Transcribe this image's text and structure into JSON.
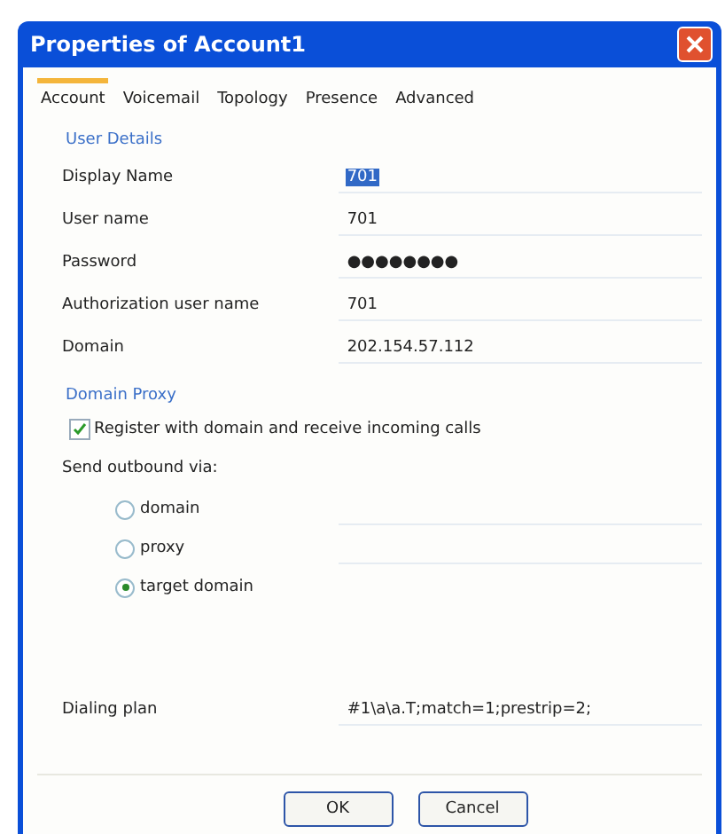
{
  "window": {
    "title": "Properties of Account1"
  },
  "tabs": [
    {
      "label": "Account",
      "selected": true
    },
    {
      "label": "Voicemail",
      "selected": false
    },
    {
      "label": "Topology",
      "selected": false
    },
    {
      "label": "Presence",
      "selected": false
    },
    {
      "label": "Advanced",
      "selected": false
    }
  ],
  "user_details": {
    "heading": "User Details",
    "fields": [
      {
        "label": "Display Name",
        "value": "701",
        "selected": true
      },
      {
        "label": "User name",
        "value": "701",
        "selected": false
      },
      {
        "label": "Password",
        "value": "●●●●●●●●",
        "selected": false
      },
      {
        "label": "Authorization user name",
        "value": "701",
        "selected": false
      },
      {
        "label": "Domain",
        "value": "202.154.57.112",
        "selected": false
      }
    ]
  },
  "domain_proxy": {
    "heading": "Domain Proxy",
    "register": {
      "label": "Register with domain and receive incoming calls",
      "checked": true
    },
    "send_label": "Send outbound via:",
    "options": [
      {
        "label": "domain",
        "selected": false,
        "has_field": true
      },
      {
        "label": "proxy",
        "selected": false,
        "has_field": true
      },
      {
        "label": "target domain",
        "selected": true,
        "has_field": false
      }
    ]
  },
  "dialing_plan": {
    "label": "Dialing plan",
    "value": "#1\\a\\a.T;match=1;prestrip=2;"
  },
  "buttons": [
    "OK",
    "Cancel"
  ]
}
